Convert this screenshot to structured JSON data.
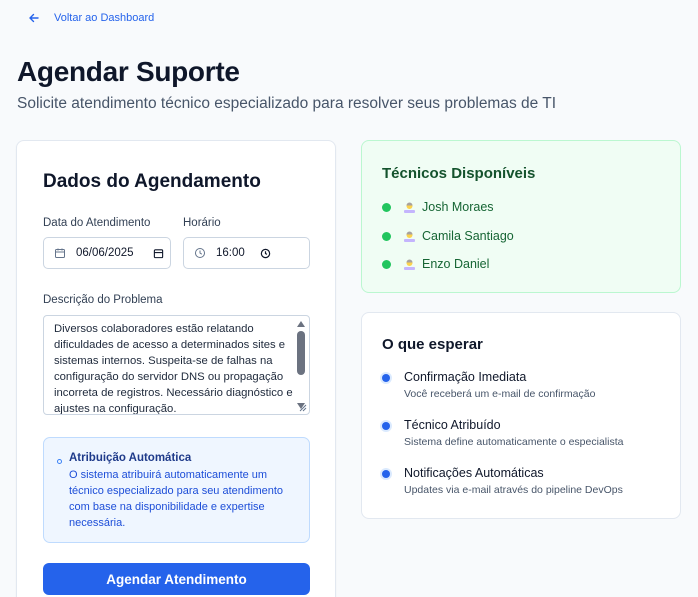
{
  "nav": {
    "back_label": "Voltar ao Dashboard"
  },
  "header": {
    "title": "Agendar Suporte",
    "subtitle": "Solicite atendimento técnico especializado para resolver seus problemas de TI"
  },
  "form": {
    "title": "Dados do Agendamento",
    "date_label": "Data do Atendimento",
    "date_value": "06/06/2025",
    "time_label": "Horário",
    "time_value": "16:00",
    "description_label": "Descrição do Problema",
    "description_value": "Diversos colaboradores estão relatando dificuldades de acesso a determinados sites e sistemas internos. Suspeita-se de falhas na configuração do servidor DNS ou propagação incorreta de registros. Necessário diagnóstico e ajustes na configuração.",
    "info_title": "Atribuição Automática",
    "info_body": "O sistema atribuirá automaticamente um técnico especializado para seu atendimento com base na disponibilidade e expertise necessária.",
    "submit_label": "Agendar Atendimento"
  },
  "technicians": {
    "title": "Técnicos Disponíveis",
    "items": [
      "Josh Moraes",
      "Camila Santiago",
      "Enzo Daniel"
    ]
  },
  "expect": {
    "title": "O que esperar",
    "items": [
      {
        "title": "Confirmação Imediata",
        "subtitle": "Você receberá um e-mail de confirmação"
      },
      {
        "title": "Técnico Atribuído",
        "subtitle": "Sistema define automaticamente o especialista"
      },
      {
        "title": "Notificações Automáticas",
        "subtitle": "Updates via e-mail através do pipeline DevOps"
      }
    ]
  },
  "colors": {
    "accent": "#2563eb",
    "available": "#22c55e",
    "tech_bg": "#f0fdf4",
    "info_bg": "#eff6ff"
  },
  "icons": {
    "back": "arrow-left-icon",
    "date": "calendar-icon",
    "time": "clock-icon",
    "tech": "technician-avatar-icon",
    "status": "online-dot-icon"
  }
}
